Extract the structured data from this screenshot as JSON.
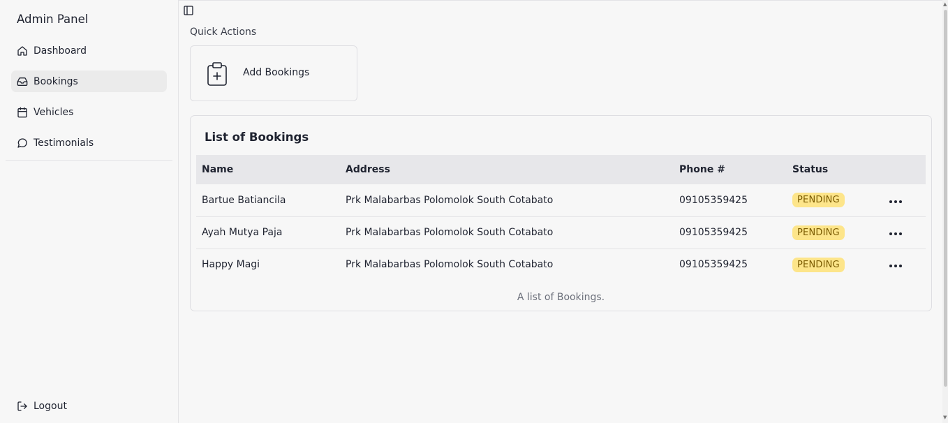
{
  "sidebar": {
    "brand": "Admin Panel",
    "items": [
      {
        "label": "Dashboard",
        "icon": "home-icon"
      },
      {
        "label": "Bookings",
        "icon": "inbox-icon",
        "active": true
      },
      {
        "label": "Vehicles",
        "icon": "calendar-icon"
      },
      {
        "label": "Testimonials",
        "icon": "message-circle-icon"
      }
    ],
    "logout_label": "Logout"
  },
  "quick_actions": {
    "label": "Quick Actions",
    "add_bookings_label": "Add Bookings"
  },
  "bookings": {
    "title": "List of Bookings",
    "columns": [
      "Name",
      "Address",
      "Phone #",
      "Status"
    ],
    "rows": [
      {
        "name": "Bartue Batiancila",
        "address": "Prk Malabarbas Polomolok South Cotabato",
        "phone": "09105359425",
        "status": "PENDING"
      },
      {
        "name": "Ayah Mutya Paja",
        "address": "Prk Malabarbas Polomolok South Cotabato",
        "phone": "09105359425",
        "status": "PENDING"
      },
      {
        "name": "Happy Magi",
        "address": "Prk Malabarbas Polomolok South Cotabato",
        "phone": "09105359425",
        "status": "PENDING"
      }
    ],
    "caption": "A list of Bookings."
  },
  "colors": {
    "status_pending_bg": "#fde58a",
    "status_pending_text": "#7a5a00"
  }
}
